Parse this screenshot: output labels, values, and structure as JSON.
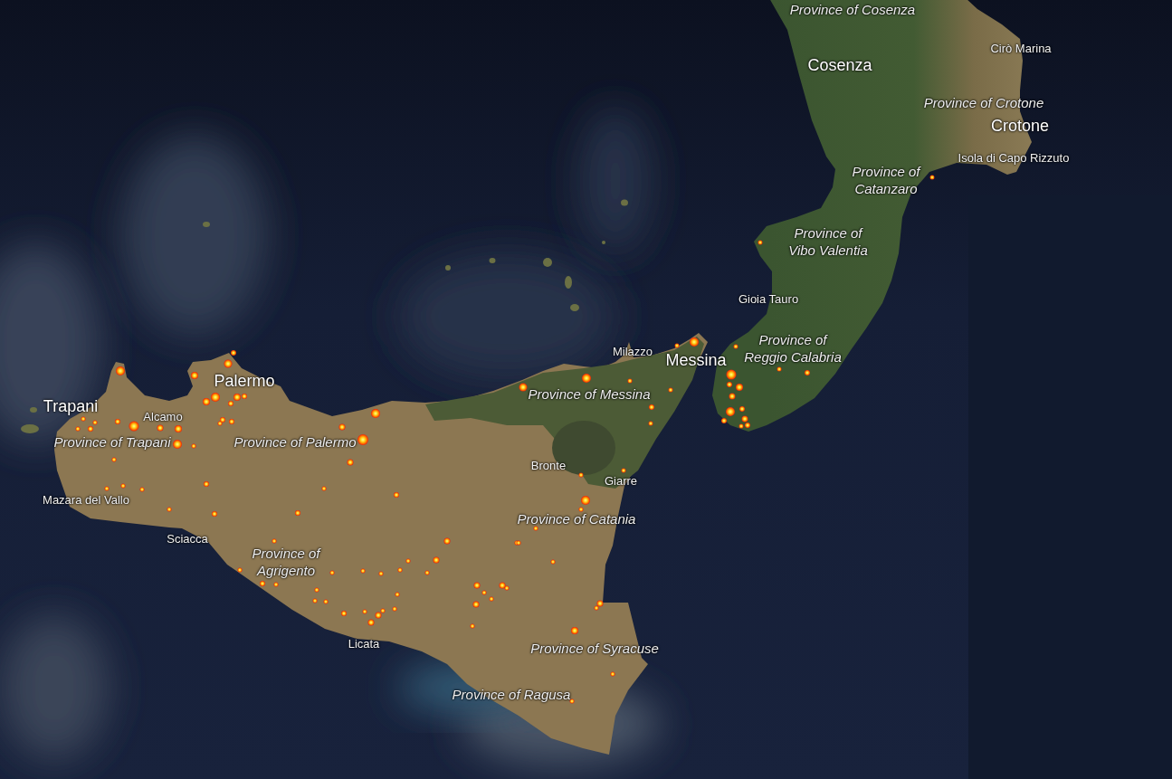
{
  "map": {
    "labels": [
      {
        "kind": "region",
        "text": "Province of Cosenza"
      },
      {
        "kind": "town",
        "text": "Cirò Marina"
      },
      {
        "kind": "city",
        "text": "Cosenza"
      },
      {
        "kind": "region",
        "text": "Province of Crotone"
      },
      {
        "kind": "city",
        "text": "Crotone"
      },
      {
        "kind": "town",
        "text": "Isola di Capo Rizzuto"
      },
      {
        "kind": "region",
        "text": "Province of Catanzaro"
      },
      {
        "kind": "region",
        "text": "Province of Vibo Valentia"
      },
      {
        "kind": "town",
        "text": "Gioia Tauro"
      },
      {
        "kind": "town",
        "text": "Milazzo"
      },
      {
        "kind": "city",
        "text": "Messina"
      },
      {
        "kind": "region",
        "text": "Province of Reggio Calabria"
      },
      {
        "kind": "city",
        "text": "Palermo"
      },
      {
        "kind": "region",
        "text": "Province of Messina"
      },
      {
        "kind": "city",
        "text": "Trapani"
      },
      {
        "kind": "town",
        "text": "Alcamo"
      },
      {
        "kind": "region",
        "text": "Province of Trapani"
      },
      {
        "kind": "region",
        "text": "Province of Palermo"
      },
      {
        "kind": "town",
        "text": "Bronte"
      },
      {
        "kind": "town",
        "text": "Giarre"
      },
      {
        "kind": "town",
        "text": "Mazara del Vallo"
      },
      {
        "kind": "region",
        "text": "Province of Catania"
      },
      {
        "kind": "town",
        "text": "Sciacca"
      },
      {
        "kind": "region",
        "text": "Province of Agrigento"
      },
      {
        "kind": "town",
        "text": "Licata"
      },
      {
        "kind": "region",
        "text": "Province of Syracuse"
      },
      {
        "kind": "region",
        "text": "Province of Ragusa"
      }
    ]
  }
}
